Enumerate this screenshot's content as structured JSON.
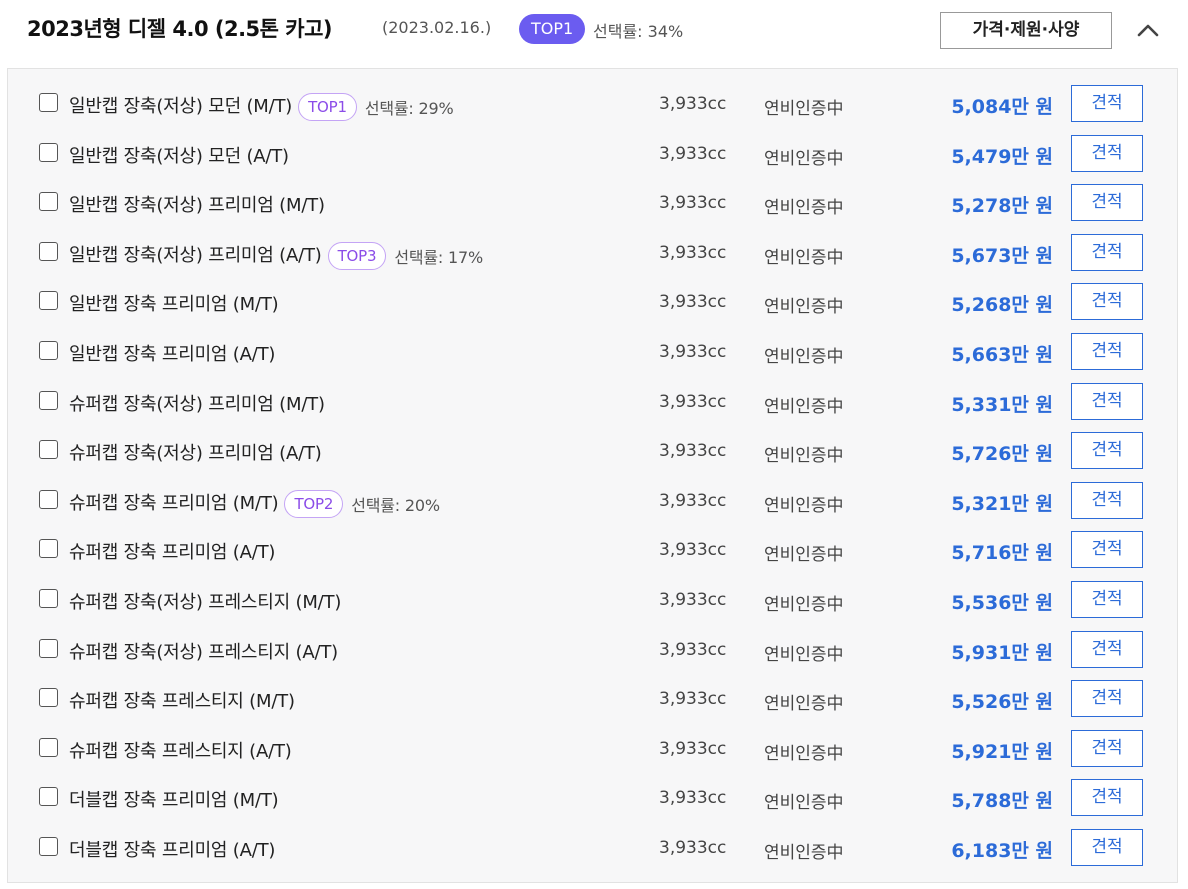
{
  "header": {
    "title": "2023년형 디젤 4.0 (2.5톤 카고)",
    "date": "(2023.02.16.)",
    "top_badge": "TOP1",
    "rate": "선택률: 34%",
    "spec_button": "가격·제원·사양"
  },
  "colors": {
    "accent_purple": "#6b5cf0",
    "badge_outline": "#c4a4f5",
    "price_blue": "#2c6bd8",
    "panel_bg": "#f7f7f8"
  },
  "icons": {
    "collapse": "chevron-up-icon",
    "checkbox": "checkbox-icon"
  },
  "trims": [
    {
      "name": "일반캡 장축(저상) 모던 (M/T)",
      "badge": "TOP1",
      "rate": "선택률: 29%",
      "displacement": "3,933cc",
      "fuel": "연비인증中",
      "price": "5,084만 원",
      "button": "견적"
    },
    {
      "name": "일반캡 장축(저상) 모던 (A/T)",
      "badge": "",
      "rate": "",
      "displacement": "3,933cc",
      "fuel": "연비인증中",
      "price": "5,479만 원",
      "button": "견적"
    },
    {
      "name": "일반캡 장축(저상) 프리미엄 (M/T)",
      "badge": "",
      "rate": "",
      "displacement": "3,933cc",
      "fuel": "연비인증中",
      "price": "5,278만 원",
      "button": "견적"
    },
    {
      "name": "일반캡 장축(저상) 프리미엄 (A/T)",
      "badge": "TOP3",
      "rate": "선택률: 17%",
      "displacement": "3,933cc",
      "fuel": "연비인증中",
      "price": "5,673만 원",
      "button": "견적"
    },
    {
      "name": "일반캡 장축 프리미엄 (M/T)",
      "badge": "",
      "rate": "",
      "displacement": "3,933cc",
      "fuel": "연비인증中",
      "price": "5,268만 원",
      "button": "견적"
    },
    {
      "name": "일반캡 장축 프리미엄 (A/T)",
      "badge": "",
      "rate": "",
      "displacement": "3,933cc",
      "fuel": "연비인증中",
      "price": "5,663만 원",
      "button": "견적"
    },
    {
      "name": "슈퍼캡 장축(저상) 프리미엄 (M/T)",
      "badge": "",
      "rate": "",
      "displacement": "3,933cc",
      "fuel": "연비인증中",
      "price": "5,331만 원",
      "button": "견적"
    },
    {
      "name": "슈퍼캡 장축(저상) 프리미엄 (A/T)",
      "badge": "",
      "rate": "",
      "displacement": "3,933cc",
      "fuel": "연비인증中",
      "price": "5,726만 원",
      "button": "견적"
    },
    {
      "name": "슈퍼캡 장축 프리미엄 (M/T)",
      "badge": "TOP2",
      "rate": "선택률: 20%",
      "displacement": "3,933cc",
      "fuel": "연비인증中",
      "price": "5,321만 원",
      "button": "견적"
    },
    {
      "name": "슈퍼캡 장축 프리미엄 (A/T)",
      "badge": "",
      "rate": "",
      "displacement": "3,933cc",
      "fuel": "연비인증中",
      "price": "5,716만 원",
      "button": "견적"
    },
    {
      "name": "슈퍼캡 장축(저상) 프레스티지 (M/T)",
      "badge": "",
      "rate": "",
      "displacement": "3,933cc",
      "fuel": "연비인증中",
      "price": "5,536만 원",
      "button": "견적"
    },
    {
      "name": "슈퍼캡 장축(저상) 프레스티지 (A/T)",
      "badge": "",
      "rate": "",
      "displacement": "3,933cc",
      "fuel": "연비인증中",
      "price": "5,931만 원",
      "button": "견적"
    },
    {
      "name": "슈퍼캡 장축 프레스티지 (M/T)",
      "badge": "",
      "rate": "",
      "displacement": "3,933cc",
      "fuel": "연비인증中",
      "price": "5,526만 원",
      "button": "견적"
    },
    {
      "name": "슈퍼캡 장축 프레스티지 (A/T)",
      "badge": "",
      "rate": "",
      "displacement": "3,933cc",
      "fuel": "연비인증中",
      "price": "5,921만 원",
      "button": "견적"
    },
    {
      "name": "더블캡 장축 프리미엄 (M/T)",
      "badge": "",
      "rate": "",
      "displacement": "3,933cc",
      "fuel": "연비인증中",
      "price": "5,788만 원",
      "button": "견적"
    },
    {
      "name": "더블캡 장축 프리미엄 (A/T)",
      "badge": "",
      "rate": "",
      "displacement": "3,933cc",
      "fuel": "연비인증中",
      "price": "6,183만 원",
      "button": "견적"
    }
  ]
}
